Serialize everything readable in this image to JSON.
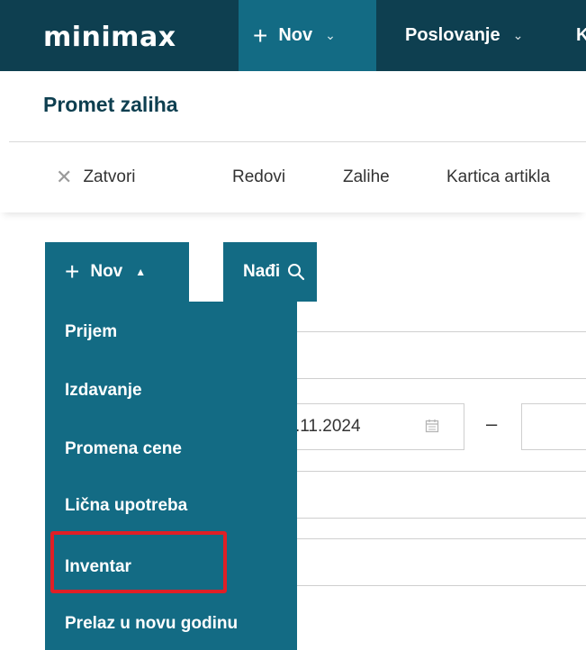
{
  "topbar": {
    "logo": "minimax",
    "new_label": "Nov",
    "business_label": "Poslovanje",
    "truncated_label": "K"
  },
  "page": {
    "title": "Promet zaliha"
  },
  "toolbar": {
    "close_label": "Zatvori",
    "rows_label": "Redovi",
    "stock_label": "Zalihe",
    "item_card_label": "Kartica artikla"
  },
  "actions": {
    "new_label": "Nov",
    "find_label": "Nađi"
  },
  "dropdown": {
    "items": [
      {
        "label": "Prijem"
      },
      {
        "label": "Izdavanje"
      },
      {
        "label": "Promena cene"
      },
      {
        "label": "Lična upotreba"
      },
      {
        "label": "Inventar",
        "highlighted": true
      },
      {
        "label": "Prelaz u novu godinu"
      }
    ]
  },
  "form": {
    "date_from_partial": ".11.2024",
    "range_separator": "–"
  },
  "colors": {
    "topbar_bg": "#0e3f50",
    "accent": "#136b84",
    "title_text": "#0e3f50",
    "highlight": "#e01f26"
  },
  "icons": [
    "plus-icon",
    "chevron-down-icon",
    "chevron-up-icon",
    "close-icon",
    "search-icon",
    "calendar-icon"
  ]
}
